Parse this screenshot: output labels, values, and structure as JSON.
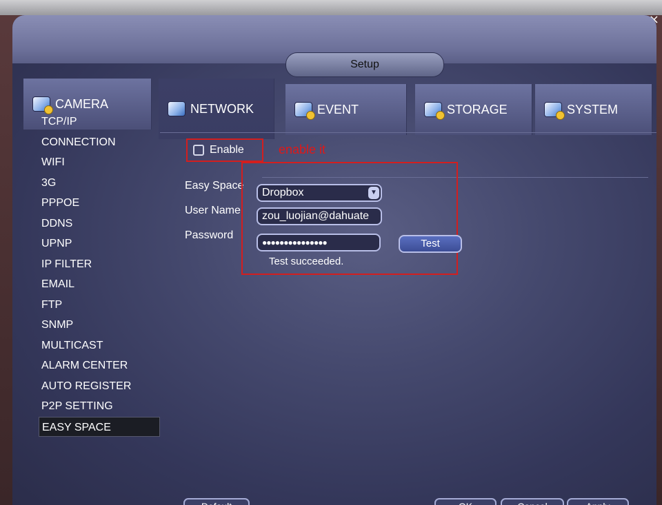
{
  "window": {
    "title": "Setup",
    "close_glyph": "×"
  },
  "tabs": [
    {
      "label": "CAMERA",
      "icon": "camera-icon"
    },
    {
      "label": "NETWORK",
      "icon": "network-icon",
      "active": true
    },
    {
      "label": "EVENT",
      "icon": "event-icon"
    },
    {
      "label": "STORAGE",
      "icon": "storage-icon"
    },
    {
      "label": "SYSTEM",
      "icon": "system-icon"
    }
  ],
  "sidebar": {
    "items": [
      {
        "label": "TCP/IP"
      },
      {
        "label": "CONNECTION"
      },
      {
        "label": "WIFI"
      },
      {
        "label": "3G"
      },
      {
        "label": "PPPOE"
      },
      {
        "label": "DDNS"
      },
      {
        "label": "UPNP"
      },
      {
        "label": "IP FILTER"
      },
      {
        "label": "EMAIL"
      },
      {
        "label": "FTP"
      },
      {
        "label": "SNMP"
      },
      {
        "label": "MULTICAST"
      },
      {
        "label": "ALARM CENTER"
      },
      {
        "label": "AUTO REGISTER"
      },
      {
        "label": "P2P SETTING"
      },
      {
        "label": "EASY SPACE",
        "active": true
      }
    ]
  },
  "form": {
    "enable_label": "Enable",
    "enable_checked": false,
    "enable_note": "enable it",
    "easy_space_label": "Easy Space",
    "easy_space_value": "Dropbox",
    "user_name_label": "User Name",
    "user_name_value": "zou_luojian@dahuate",
    "password_label": "Password",
    "password_value": "●●●●●●●●●●●●●●●",
    "test_button": "Test",
    "status": "Test succeeded."
  },
  "footer": {
    "default_button": "Default",
    "ok_button": "OK",
    "cancel_button": "Cancel",
    "apply_button": "Apply"
  },
  "colors": {
    "annotation_red": "#d41e1e",
    "screen_bg": "#45496e",
    "active_sidebar_bg": "#1b1d24"
  }
}
